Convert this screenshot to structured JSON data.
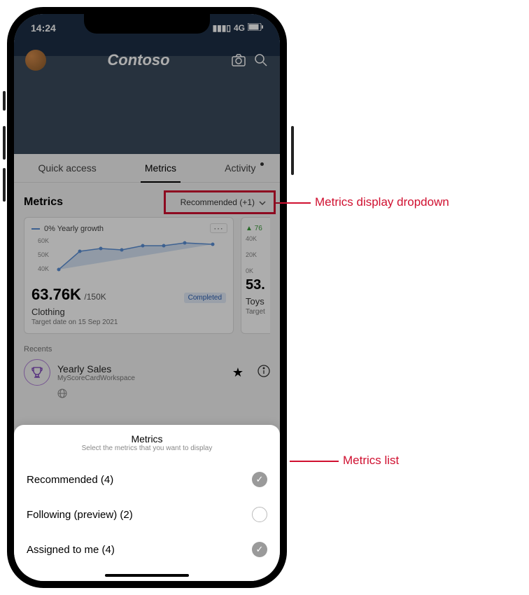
{
  "status": {
    "time": "14:24",
    "network": "4G"
  },
  "header": {
    "brand": "Contoso"
  },
  "tabs": {
    "quick_access": "Quick access",
    "metrics": "Metrics",
    "activity": "Activity"
  },
  "metrics_section": {
    "title": "Metrics",
    "dropdown_label": "Recommended (+1)"
  },
  "card1": {
    "growth": "0% Yearly growth",
    "axis": {
      "a": "60K",
      "b": "50K",
      "c": "40K"
    },
    "value": "63.76K",
    "denom": "/150K",
    "status": "Completed",
    "name": "Clothing",
    "target": "Target date on 15 Sep 2021"
  },
  "card2": {
    "growth_prefix": "76",
    "axis": {
      "a": "40K",
      "b": "20K",
      "c": "0K"
    },
    "value": "53.",
    "name": "Toys",
    "target": "Target"
  },
  "recents": {
    "label": "Recents",
    "item1_title": "Yearly Sales",
    "item1_sub": "MyScoreCardWorkspace"
  },
  "sheet": {
    "title": "Metrics",
    "sub": "Select the metrics that you want to display",
    "opt1": "Recommended (4)",
    "opt2": "Following (preview) (2)",
    "opt3": "Assigned to me (4)"
  },
  "callouts": {
    "dropdown": "Metrics display dropdown",
    "list": "Metrics list"
  },
  "chart_data": {
    "type": "line",
    "title": "0% Yearly growth",
    "ylabel": "",
    "ylim": [
      40000,
      60000
    ],
    "y_ticks": [
      "60K",
      "50K",
      "40K"
    ],
    "x": [
      0,
      1,
      2,
      3,
      4,
      5,
      6,
      7
    ],
    "values": [
      42000,
      55000,
      57000,
      56000,
      59000,
      59000,
      60000,
      59000
    ],
    "series_name": "Yearly growth",
    "color": "#5a8fd6"
  }
}
